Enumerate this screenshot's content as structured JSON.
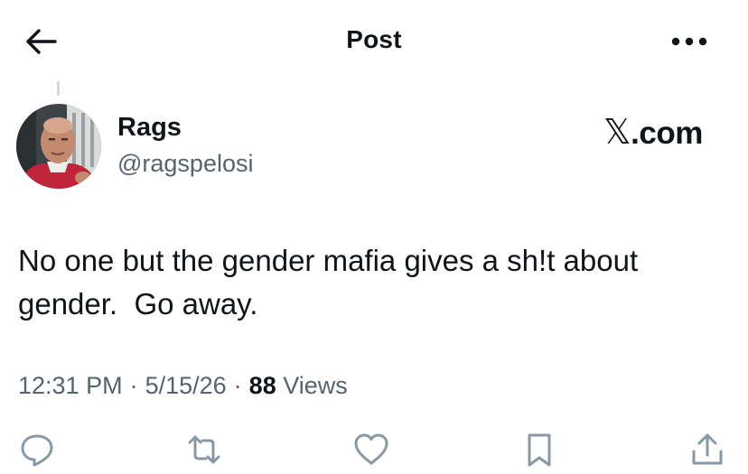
{
  "header": {
    "title": "Post",
    "back_icon": "arrow-left-icon",
    "more_icon": "more-horizontal-icon"
  },
  "author": {
    "display_name": "Rags",
    "handle": "@ragspelosi"
  },
  "brand": {
    "logo_glyph": "𝕏",
    "logo_suffix": ".com"
  },
  "tweet": {
    "text": "No one but the gender mafia gives a sh!t about\ngender.  Go away."
  },
  "meta": {
    "time": "12:31 PM",
    "separator": "·",
    "date": "5/15/26",
    "views_count": "88",
    "views_label": "Views"
  },
  "actions": [
    {
      "icon": "reply-icon"
    },
    {
      "icon": "repost-icon"
    },
    {
      "icon": "like-icon"
    },
    {
      "icon": "bookmark-icon"
    },
    {
      "icon": "share-icon"
    }
  ],
  "colors": {
    "text_primary": "#0f1419",
    "text_secondary": "#536471",
    "icon_muted": "#8899a6",
    "divider": "#cfd9de"
  }
}
